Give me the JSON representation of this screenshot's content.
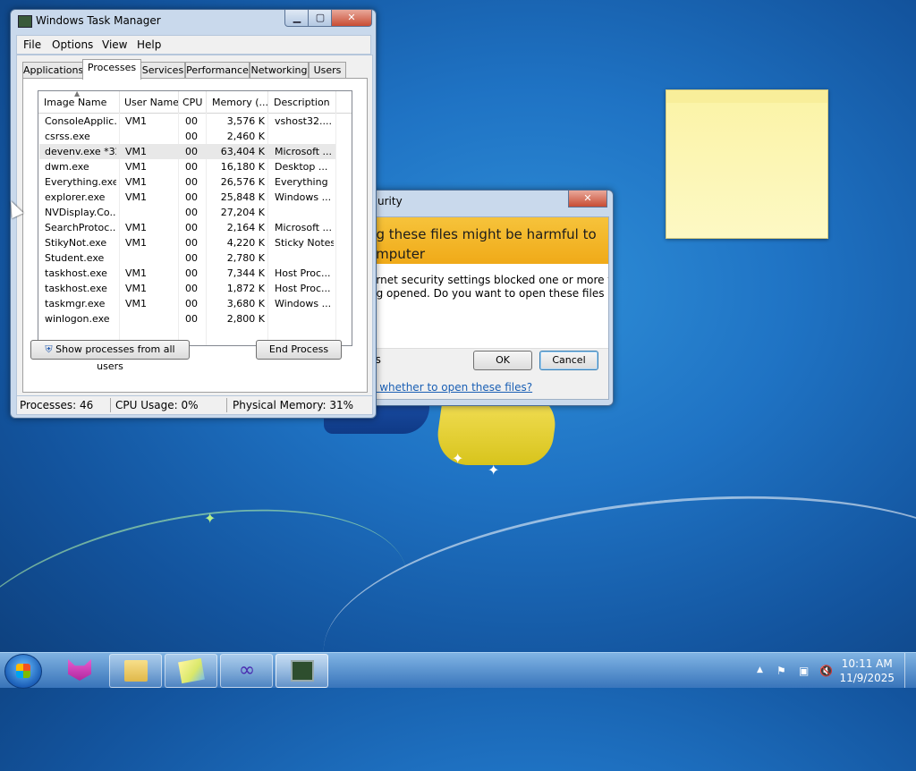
{
  "task_manager": {
    "title": "Windows Task Manager",
    "menu": [
      "File",
      "Options",
      "View",
      "Help"
    ],
    "tabs": [
      "Applications",
      "Processes",
      "Services",
      "Performance",
      "Networking",
      "Users"
    ],
    "active_tab": "Processes",
    "columns": [
      "Image Name",
      "User Name",
      "CPU",
      "Memory (...",
      "Description"
    ],
    "rows": [
      {
        "image": "ConsoleApplic...",
        "user": "VM1",
        "cpu": "00",
        "memory": "3,576 K",
        "desc": "vshost32...."
      },
      {
        "image": "csrss.exe",
        "user": "",
        "cpu": "00",
        "memory": "2,460 K",
        "desc": ""
      },
      {
        "image": "devenv.exe *32",
        "user": "VM1",
        "cpu": "00",
        "memory": "63,404 K",
        "desc": "Microsoft ..."
      },
      {
        "image": "dwm.exe",
        "user": "VM1",
        "cpu": "00",
        "memory": "16,180 K",
        "desc": "Desktop ..."
      },
      {
        "image": "Everything.exe",
        "user": "VM1",
        "cpu": "00",
        "memory": "26,576 K",
        "desc": "Everything"
      },
      {
        "image": "explorer.exe",
        "user": "VM1",
        "cpu": "00",
        "memory": "25,848 K",
        "desc": "Windows ..."
      },
      {
        "image": "NVDisplay.Co...",
        "user": "",
        "cpu": "00",
        "memory": "27,204 K",
        "desc": ""
      },
      {
        "image": "SearchProtoc...",
        "user": "VM1",
        "cpu": "00",
        "memory": "2,164 K",
        "desc": "Microsoft ..."
      },
      {
        "image": "StikyNot.exe",
        "user": "VM1",
        "cpu": "00",
        "memory": "4,220 K",
        "desc": "Sticky Notes"
      },
      {
        "image": "Student.exe",
        "user": "",
        "cpu": "00",
        "memory": "2,780 K",
        "desc": ""
      },
      {
        "image": "taskhost.exe",
        "user": "VM1",
        "cpu": "00",
        "memory": "7,344 K",
        "desc": "Host Proc..."
      },
      {
        "image": "taskhost.exe",
        "user": "VM1",
        "cpu": "00",
        "memory": "1,872 K",
        "desc": "Host Proc..."
      },
      {
        "image": "taskmgr.exe",
        "user": "VM1",
        "cpu": "00",
        "memory": "3,680 K",
        "desc": "Windows ..."
      },
      {
        "image": "winlogon.exe",
        "user": "",
        "cpu": "00",
        "memory": "2,800 K",
        "desc": ""
      }
    ],
    "show_all_label": "Show processes from all users",
    "end_process_label": "End Process",
    "status": {
      "processes": "Processes: 46",
      "cpu": "CPU Usage: 0%",
      "memory": "Physical Memory: 31%"
    }
  },
  "security_dialog": {
    "title_partial": "urity",
    "warning_line1": "ng these files might be harmful to",
    "warning_line2": "omputer",
    "message_line1": "ernet security settings blocked one or more files",
    "message_line2": "ng opened. Do you want to open these files",
    "details_partial": "ils",
    "ok_label": "OK",
    "cancel_label": "Cancel",
    "link_partial": "e whether to open these files?"
  },
  "taskbar": {
    "time": "10:11 AM",
    "date": "11/9/2025",
    "apps": [
      "fox-app-icon",
      "folder-icon",
      "notes-icon",
      "visual-studio-icon",
      "task-manager-icon"
    ]
  },
  "colors": {
    "warning_band": "#f0aa18",
    "link": "#1a5fb4",
    "desktop": "#1f73c4"
  }
}
